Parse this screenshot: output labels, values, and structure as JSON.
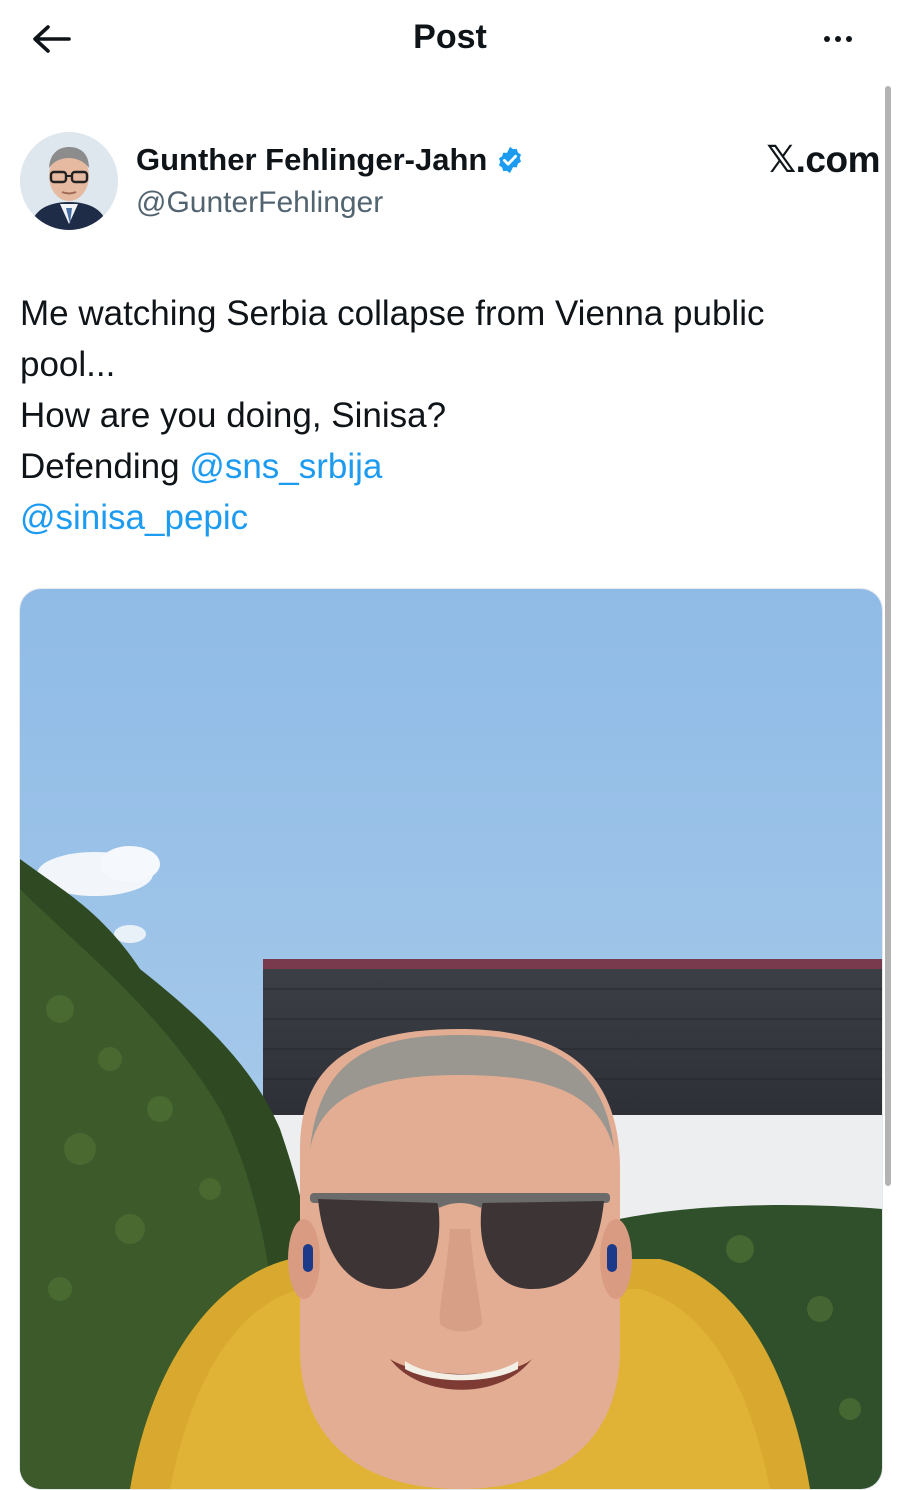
{
  "header": {
    "title": "Post",
    "back_icon": "arrow-left-icon",
    "more_icon": "more-horizontal-icon"
  },
  "author": {
    "display_name": "Gunther Fehlinger-Jahn",
    "verified_icon": "verified-badge-icon",
    "handle": "@GunterFehlinger",
    "brand": "𝕏.com"
  },
  "tweet": {
    "lines": [
      "Me watching Serbia collapse from Vienna public",
      "pool...",
      "How are you doing, Sinisa?"
    ],
    "defending_prefix": "Defending ",
    "mention_1": "@sns_srbija",
    "mention_2": "@sinisa_pepic"
  },
  "colors": {
    "link": "#1d9bf0",
    "verified": "#1d9bf0",
    "text": "#0f1419",
    "secondary": "#536471"
  }
}
